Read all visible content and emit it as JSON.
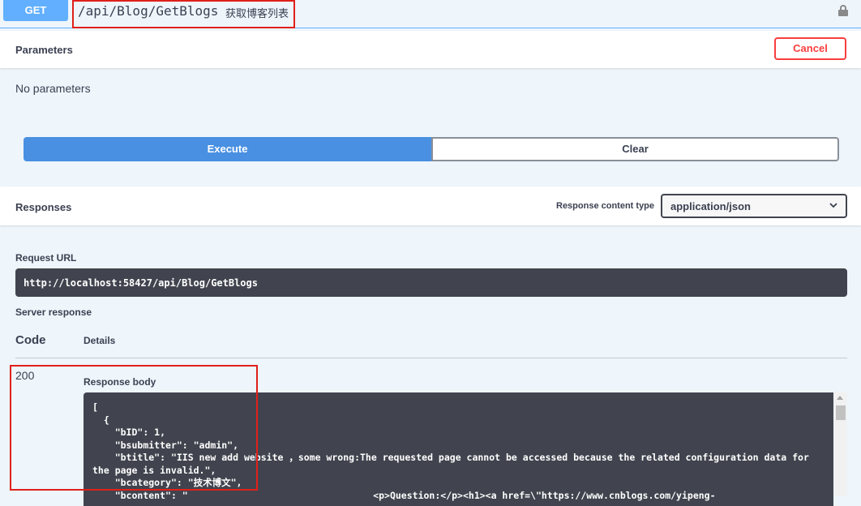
{
  "operation": {
    "method": "GET",
    "path": "/api/Blog/GetBlogs",
    "summary": "获取博客列表"
  },
  "parameters": {
    "title": "Parameters",
    "cancel_label": "Cancel",
    "empty_text": "No parameters"
  },
  "actions": {
    "execute_label": "Execute",
    "clear_label": "Clear"
  },
  "responses": {
    "title": "Responses",
    "content_type_label": "Response content type",
    "content_type_value": "application/json",
    "request_url_label": "Request URL",
    "request_url": "http://localhost:58427/api/Blog/GetBlogs",
    "server_response_label": "Server response",
    "code_header": "Code",
    "details_header": "Details",
    "status_code": "200",
    "body_label": "Response body",
    "body_text": "[\n  {\n    \"bID\": 1,\n    \"bsubmitter\": \"admin\",\n    \"btitle\": \"IIS new add website ，some wrong:The requested page cannot be accessed because the related configuration data for the page is invalid.\",\n    \"bcategory\": \"技术博文\",\n    \"bcontent\": \"                                 <p>Question:</p><h1><a href=\\\"https://www.cnblogs.com/yipeng-"
  },
  "colors": {
    "get": "#61affe",
    "execute": "#4990e2",
    "cancel": "#f93e3e",
    "highlight": "#e0201b",
    "code_bg": "#41444e"
  }
}
